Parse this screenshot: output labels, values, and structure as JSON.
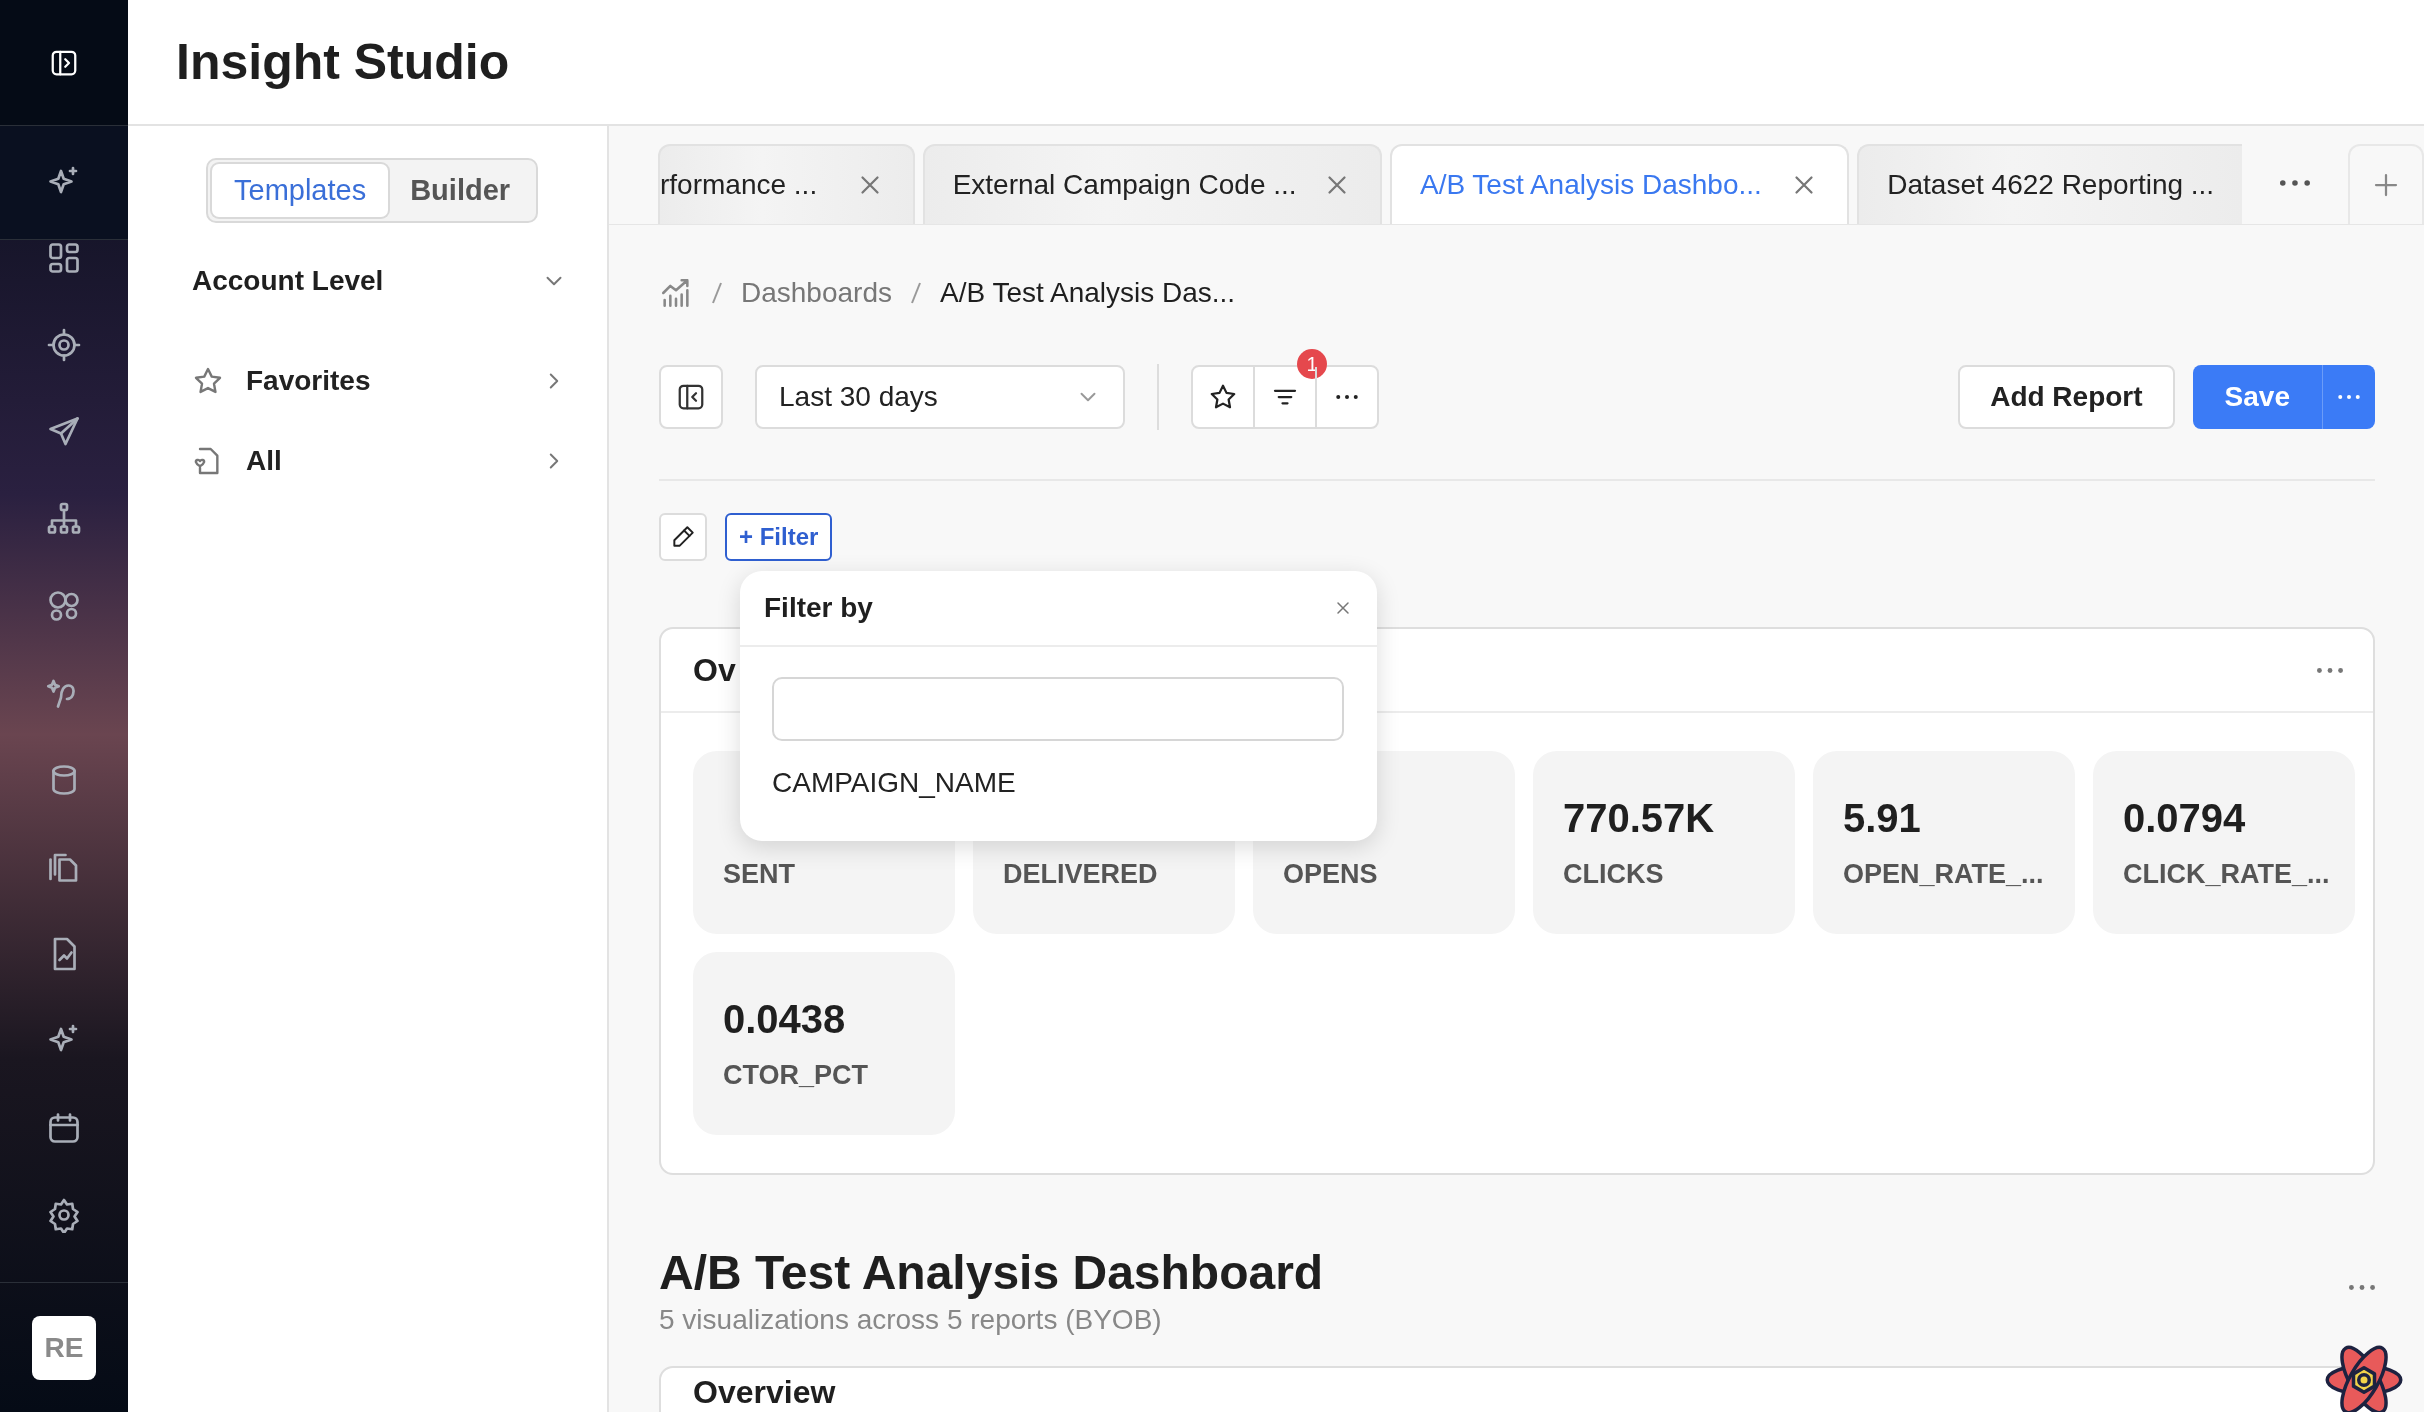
{
  "rail": {
    "avatar": "RE"
  },
  "header": {
    "title": "Insight Studio"
  },
  "sidebar": {
    "segments": [
      {
        "label": "Templates",
        "selected": true
      },
      {
        "label": "Builder",
        "selected": false
      }
    ],
    "section": {
      "label": "Account Level",
      "expanded": true
    },
    "items": [
      {
        "label": "Favorites",
        "kind": "favorites"
      },
      {
        "label": "All",
        "kind": "all"
      }
    ]
  },
  "tabs": [
    {
      "label": "rformance ...",
      "selected": false,
      "closable": true
    },
    {
      "label": "External Campaign Code ...",
      "selected": false,
      "closable": true
    },
    {
      "label": "A/B Test Analysis Dashbo...",
      "selected": true,
      "closable": true
    },
    {
      "label": "Dataset 4622 Reporting ...",
      "selected": false,
      "closable": false
    }
  ],
  "breadcrumb": [
    "Dashboards",
    "A/B Test Analysis Das..."
  ],
  "toolbar": {
    "date_range": "Last 30 days",
    "filter_badge": "1",
    "add_report": "Add Report",
    "save": "Save"
  },
  "filter_button": "+ Filter",
  "filter_popup": {
    "title": "Filter by",
    "options": [
      "CAMPAIGN_NAME"
    ]
  },
  "overview_card": {
    "title": "Ov",
    "metrics": [
      {
        "label": "SENT"
      },
      {
        "label": "DELIVERED"
      },
      {
        "label": "OPENS"
      },
      {
        "value": "770.57K",
        "label": "CLICKS"
      },
      {
        "value": "5.91",
        "label": "OPEN_RATE_..."
      },
      {
        "value": "0.0794",
        "label": "CLICK_RATE_..."
      },
      {
        "value": "0.0438",
        "label": "CTOR_PCT"
      }
    ]
  },
  "dashboard": {
    "title": "A/B Test Analysis Dashboard",
    "subtitle": "5 visualizations across 5 reports (BYOB)",
    "next_card_title": "Overview"
  }
}
